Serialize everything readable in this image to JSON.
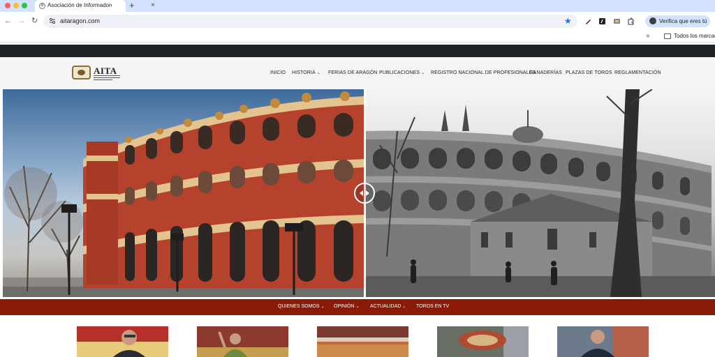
{
  "browser": {
    "tab_title": "Asociación de Informadores T",
    "url": "aitaragon.com",
    "profile_label": "Verifica que eres tú",
    "bookmarks_label": "Todos los marcado"
  },
  "site": {
    "logo_text": "AITA",
    "nav": [
      {
        "label": "INICIO"
      },
      {
        "label": "HISTORIA",
        "dropdown": true
      },
      {
        "label": "FERIAS DE ARAGÓN"
      },
      {
        "label": "PUBLICACIONES",
        "dropdown": true
      },
      {
        "label": "REGISTRO NACIONAL DE PROFESIONALES"
      },
      {
        "label": "GANADERÍAS"
      },
      {
        "label": "PLAZAS DE TOROS"
      },
      {
        "label": "REGLAMENTACIÓN"
      }
    ],
    "secondary_nav": [
      {
        "label": "QUIENES SOMOS",
        "dropdown": true
      },
      {
        "label": "OPINIÓN",
        "dropdown": true
      },
      {
        "label": "ACTUALIDAD",
        "dropdown": true
      },
      {
        "label": "TOROS EN TV"
      }
    ]
  },
  "colors": {
    "tabbar": "#d3e3fd",
    "topstrip": "#1d2327",
    "secondary_nav": "#8b1a06",
    "brick": "#b5422c",
    "stone": "#e3c48e"
  }
}
